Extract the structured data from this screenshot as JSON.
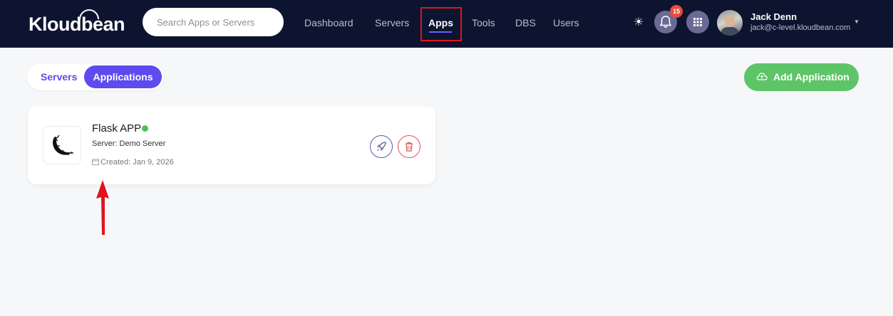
{
  "brand": {
    "name": "Kloudbean"
  },
  "search": {
    "placeholder": "Search Apps or Servers"
  },
  "nav": {
    "items": [
      {
        "label": "Dashboard"
      },
      {
        "label": "Servers"
      },
      {
        "label": "Apps",
        "active": true
      },
      {
        "label": "Tools"
      },
      {
        "label": "DBS"
      },
      {
        "label": "Users"
      }
    ]
  },
  "notifications": {
    "count": "15"
  },
  "user": {
    "name": "Jack Denn",
    "email": "jack@c-level.kloudbean.com"
  },
  "toggle": {
    "servers_label": "Servers",
    "applications_label": "Applications"
  },
  "actions": {
    "add_application_label": "Add Application"
  },
  "app_card": {
    "name": "Flask APP",
    "server": "Server: Demo Server",
    "created": "Created: Jan 9, 2026",
    "status": "running"
  },
  "icons": {
    "theme": "sun-icon",
    "notifications": "bell-icon",
    "apps_menu": "grid-icon",
    "add": "cloud-upload-icon",
    "calendar": "calendar-icon",
    "deploy": "rocket-icon",
    "delete": "trash-icon",
    "app_logo": "flask-logo-icon"
  },
  "colors": {
    "topbar": "#0d1430",
    "accent": "#5d4bf0",
    "success": "#5ec468",
    "status_running": "#4cc25a",
    "danger": "#e0505c",
    "highlight_box": "#e0141b",
    "annotation_arrow": "#e0141b"
  }
}
